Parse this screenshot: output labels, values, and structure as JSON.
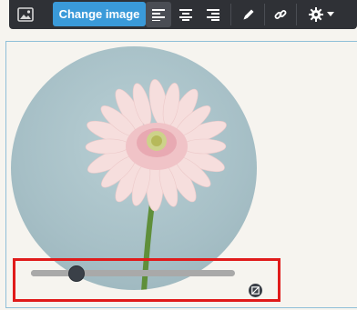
{
  "toolbar": {
    "change_image_label": "Change image",
    "icons": [
      "image-icon",
      "align-left-icon",
      "align-center-icon",
      "align-right-icon",
      "pencil-icon",
      "link-icon",
      "gear-icon",
      "caret-down-icon"
    ],
    "active_alignment": "left"
  },
  "image": {
    "shape": "circle",
    "zoom_slider": {
      "value": 0.22
    },
    "reset_icon": "reset-icon"
  },
  "colors": {
    "toolbar_bg": "#2f3136",
    "primary_button": "#3a9ad9",
    "highlight_border": "#e01b1b",
    "editor_border": "#8fbfd8"
  }
}
